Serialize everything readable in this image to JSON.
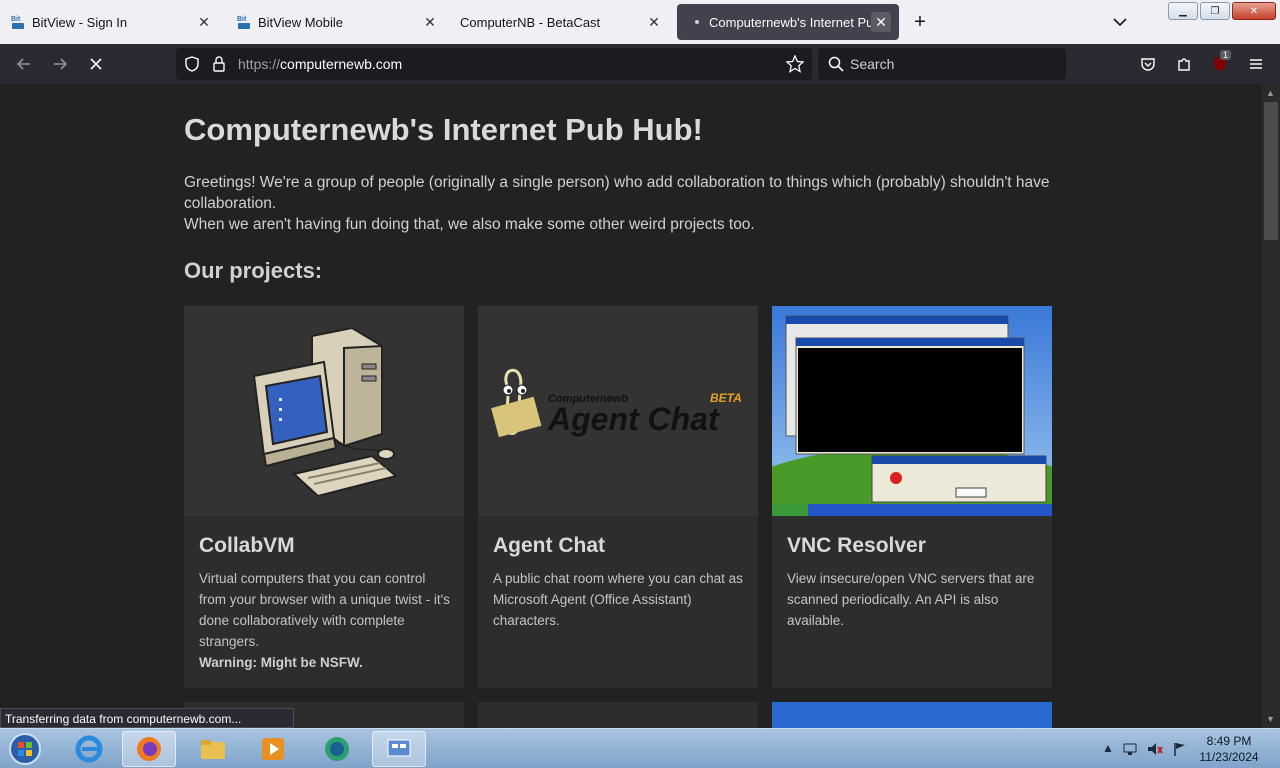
{
  "tabs": [
    {
      "title": "BitView - Sign In",
      "favicon": "bitview-icon"
    },
    {
      "title": "BitView Mobile",
      "favicon": "bitview-icon"
    },
    {
      "title": "ComputerNB - BetaCast",
      "favicon": ""
    },
    {
      "title": "Computernewb's Internet Pub",
      "favicon": "loading-dot"
    }
  ],
  "new_tab_label": "+",
  "url": {
    "prefix": "https://",
    "host": "computernewb.com"
  },
  "search_placeholder": "Search",
  "extension_badge": "1",
  "page": {
    "title": "Computernewb's Internet Pub Hub!",
    "intro_line1": "Greetings! We're a group of people (originally a single person) who add collaboration to things which (probably) shouldn't have collaboration.",
    "intro_line2": "When we aren't having fun doing that, we also make some other weird projects too.",
    "projects_heading": "Our projects:",
    "projects": [
      {
        "name": "CollabVM",
        "description": "Virtual computers that you can control from your browser with a unique twist - it's done collaboratively with complete strangers.",
        "warning": "Warning: Might be NSFW."
      },
      {
        "name": "Agent Chat",
        "description": "A public chat room where you can chat as Microsoft Agent (Office Assistant) characters.",
        "logo_small": "Computernewb",
        "logo_big": "Agent Chat",
        "logo_badge": "BETA"
      },
      {
        "name": "VNC Resolver",
        "description": "View insecure/open VNC servers that are scanned periodically. An API is also available."
      }
    ]
  },
  "status_text": "Transferring data from computernewb.com...",
  "clock": {
    "time": "8:49 PM",
    "date": "11/23/2024"
  },
  "colors": {
    "accent": "#42414d",
    "page_bg": "#222222",
    "card_bg": "#2d2d2d"
  }
}
